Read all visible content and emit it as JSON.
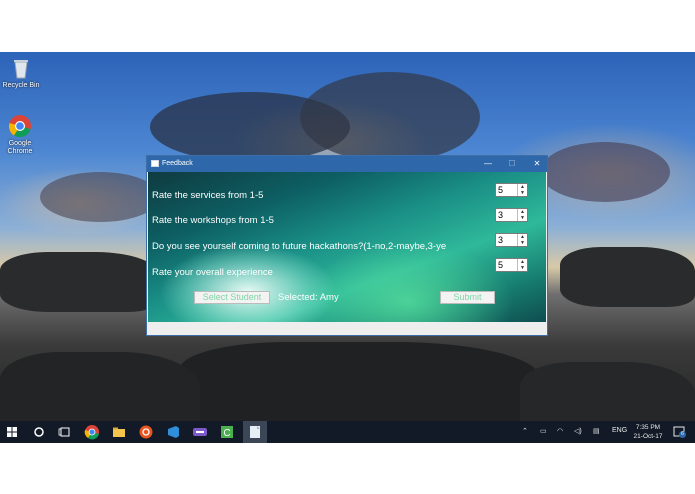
{
  "desktop": {
    "icons": [
      {
        "label": "Recycle Bin",
        "icon": "recycle-bin-icon"
      },
      {
        "label": "Google Chrome",
        "icon": "chrome-icon"
      }
    ]
  },
  "window": {
    "title": "Feedback",
    "controls": {
      "minimize": "—",
      "maximize": "☐",
      "close": "✕"
    }
  },
  "form": {
    "questions": [
      {
        "label": "Rate the services from 1-5",
        "value": "5"
      },
      {
        "label": "Rate the workshops from 1-5",
        "value": "3"
      },
      {
        "label": "Do you see yourself coming to future hackathons?(1-no,2-maybe,3-ye",
        "value": "3"
      },
      {
        "label": "Rate your overall experience",
        "value": "5"
      }
    ],
    "select_student_label": "Select Student",
    "selected_text": "Selected: Amy",
    "submit_label": "Submit"
  },
  "taskbar": {
    "apps": [
      "start-icon",
      "search-icon",
      "task-view-icon",
      "chrome-icon",
      "file-explorer-icon",
      "ubuntu-icon",
      "visual-studio-icon",
      "terminal-icon",
      "camtasia-icon",
      "feedback-app-icon"
    ],
    "language": "ENG",
    "time": "7:35 PM",
    "date": "21-Oct-17",
    "notification_count": "6"
  },
  "colors": {
    "titlebar": "#2e68aa",
    "taskbar": "#111a26",
    "button_text": "#7fd6a5"
  }
}
